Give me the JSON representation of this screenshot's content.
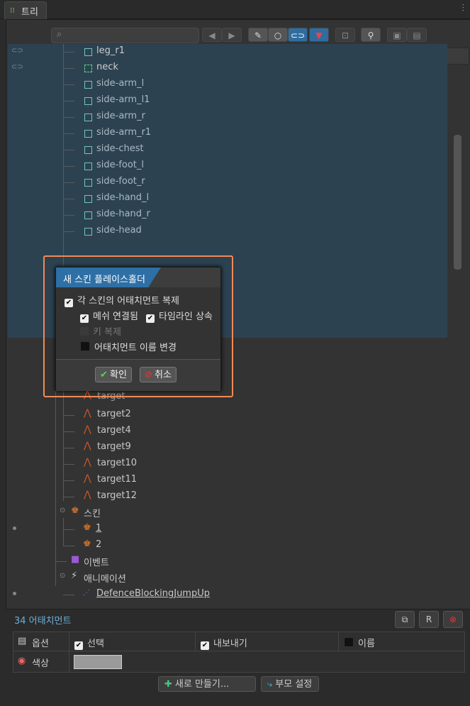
{
  "window": {
    "tab_label": "트리"
  },
  "tree_rows": [
    {
      "label": "leg_r1"
    },
    {
      "label": "neck"
    },
    {
      "label": "side-arm_l"
    },
    {
      "label": "side-arm_l1"
    },
    {
      "label": "side-arm_r"
    },
    {
      "label": "side-arm_r1"
    },
    {
      "label": "side-chest"
    },
    {
      "label": "side-foot_l"
    },
    {
      "label": "side-foot_r"
    },
    {
      "label": "side-hand_l"
    },
    {
      "label": "side-hand_r"
    },
    {
      "label": "side-head"
    }
  ],
  "lower_rows": {
    "partial_target": "target",
    "targets": [
      "target2",
      "target4",
      "target9",
      "target10",
      "target11",
      "target12"
    ],
    "skins_label": "스킨",
    "skin_items": [
      "1",
      "2"
    ],
    "events_label": "이벤트",
    "animations_label": "애니메이션",
    "animation_item": "DefenceBlockingJumpUp"
  },
  "dialog": {
    "title": "새 스킨 플레이스홀더",
    "opt_duplicate": "각 스킨의 어태치먼트 복제",
    "opt_mesh_linked": "메쉬 연결됨",
    "opt_inherit_timeline": "타임라인 상속",
    "opt_duplicate_keys": "키 복제",
    "opt_rename": "어태치먼트 이름 변경",
    "ok": "확인",
    "cancel": "취소"
  },
  "bottom": {
    "count": "34 어태치먼트",
    "options_label": "옵션",
    "select_label": "선택",
    "export_label": "내보내기",
    "name_label": "이름",
    "color_label": "색상",
    "new_button": "새로 만들기...",
    "parent_button": "부모 설정"
  }
}
